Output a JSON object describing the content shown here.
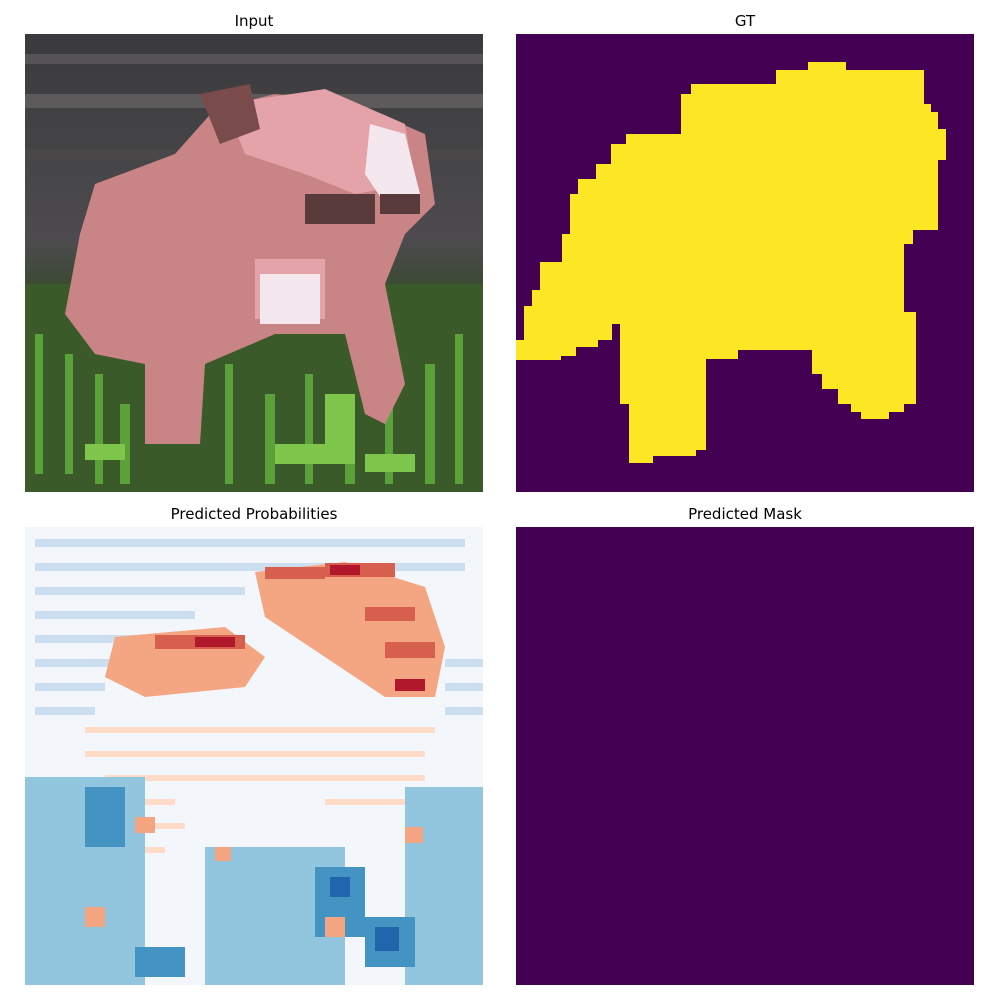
{
  "panels": {
    "input": {
      "title": "Input",
      "content": "pixelated photo of a pink puppy standing in green grass"
    },
    "gt": {
      "title": "GT",
      "colors": {
        "background": "#440154",
        "foreground": "#fde725"
      }
    },
    "prob": {
      "title": "Predicted Probabilities",
      "colormap": "RdBu_r"
    },
    "mask": {
      "title": "Predicted Mask",
      "colors": {
        "background": "#440154"
      }
    }
  }
}
